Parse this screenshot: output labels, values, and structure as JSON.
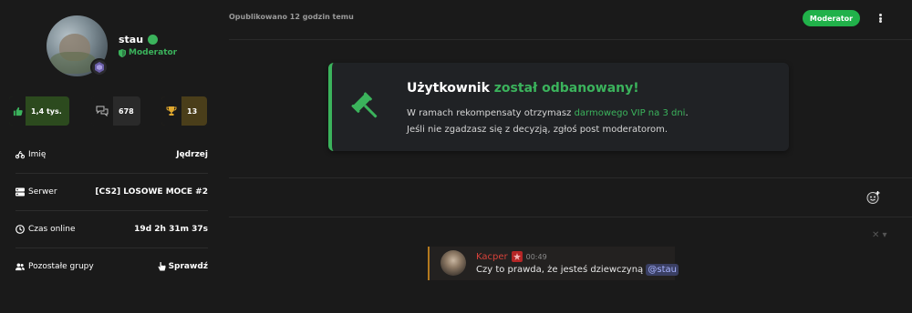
{
  "profile": {
    "username": "stau",
    "role": "Moderator",
    "status_color": "#3bb35c"
  },
  "stats": {
    "likes": "1,4 tys.",
    "comments": "678",
    "trophies": "13"
  },
  "info": [
    {
      "icon": "motorcycle-icon",
      "label": "Imię",
      "value": "Jędrzej"
    },
    {
      "icon": "server-icon",
      "label": "Serwer",
      "value": "[CS2] LOSOWE MOCE #2"
    },
    {
      "icon": "clock-icon",
      "label": "Czas online",
      "value": "19d 2h 31m 37s"
    },
    {
      "icon": "users-icon",
      "label": "Pozostałe grupy",
      "value": "Sprawdź"
    }
  ],
  "post": {
    "published": "Opublikowano 12 godzin temu",
    "badge": "Moderator"
  },
  "ban": {
    "title_a": "Użytkownik",
    "title_b": "został odbanowany!",
    "line1_a": "W ramach rekompensaty otrzymasz",
    "line1_b": "darmowego VIP na 3 dni",
    "line1_c": ".",
    "line2": "Jeśli nie zgadzasz się z decyzją, zgłoś post moderatorom."
  },
  "reply": {
    "author": "Kacper",
    "time": "00:49",
    "text": "Czy to prawda, że jesteś dziewczyną",
    "mention": "@stau"
  },
  "colors": {
    "accent": "#3bb35c",
    "badge": "#21b14a",
    "reply_border": "#b3791e",
    "author": "#d6423a"
  }
}
